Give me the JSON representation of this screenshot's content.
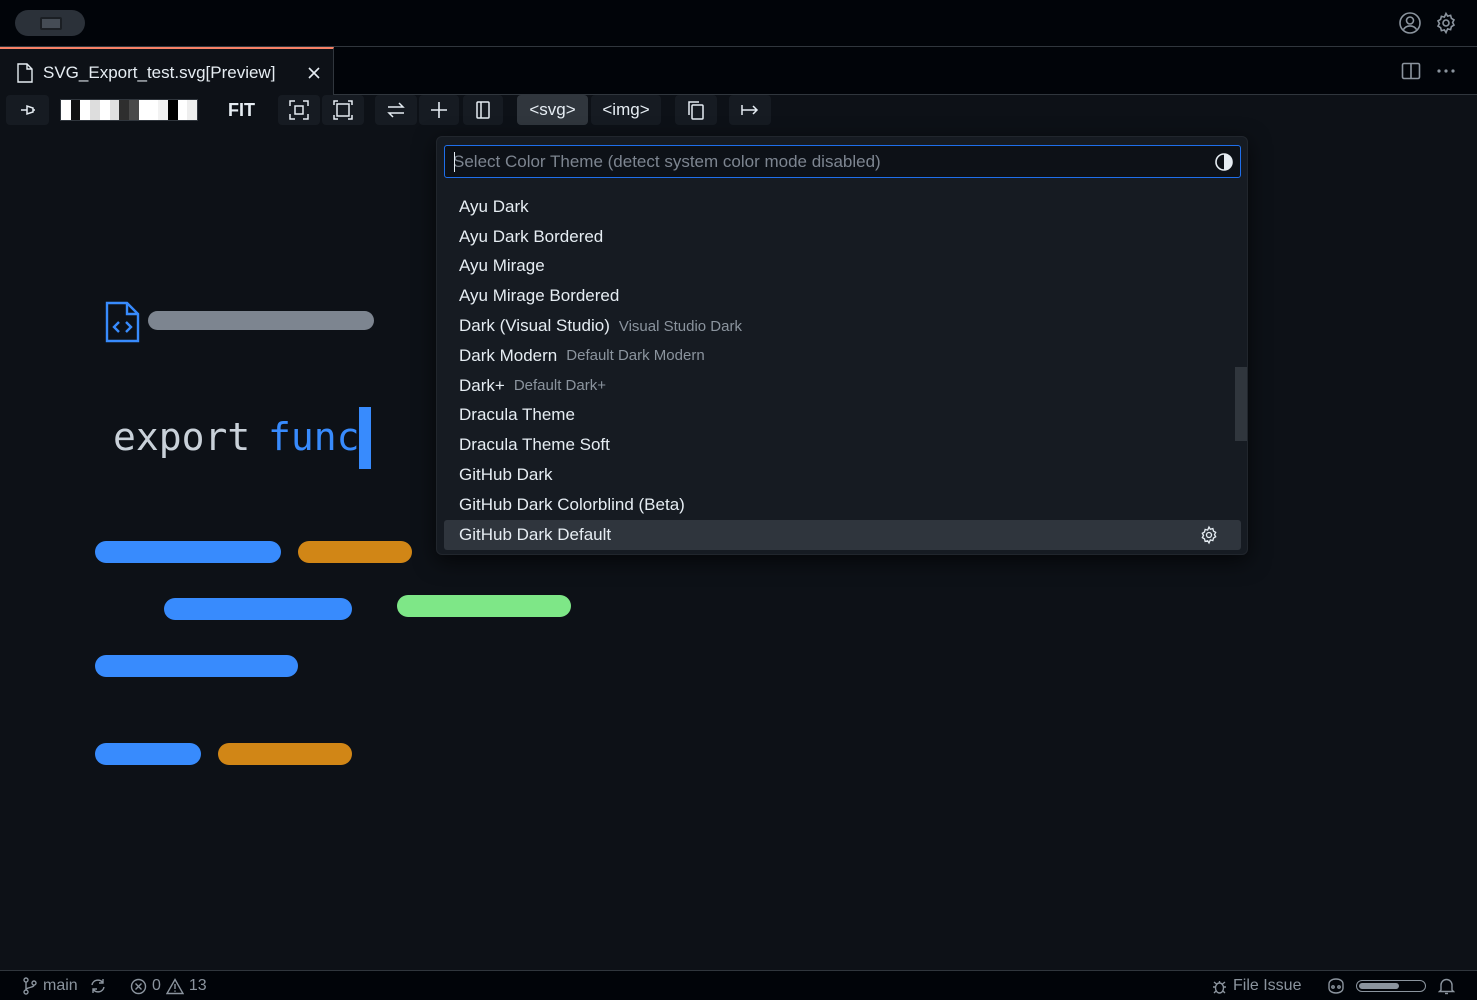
{
  "tab": {
    "title": "SVG_Export_test.svg[Preview]"
  },
  "toolbar": {
    "fit_label": "FIT",
    "svg_label": "<svg>",
    "img_label": "<img>",
    "background_swatches": [
      "#ffffff",
      "#111111",
      "#ffffff",
      "#dddddd",
      "#ffffff",
      "#e0e0e0",
      "#2e2e2e",
      "#4a4a4a",
      "#ffffff",
      "#ffffff",
      "#f2f2f2",
      "#000000",
      "#ffffff",
      "#eeeeee"
    ]
  },
  "preview": {
    "code_keyword": "export",
    "code_name": "func"
  },
  "quickpick": {
    "placeholder": "Select Color Theme (detect system color mode disabled)",
    "items": [
      {
        "label": "Ayu Dark",
        "description": ""
      },
      {
        "label": "Ayu Dark Bordered",
        "description": ""
      },
      {
        "label": "Ayu Mirage",
        "description": ""
      },
      {
        "label": "Ayu Mirage Bordered",
        "description": ""
      },
      {
        "label": "Dark (Visual Studio)",
        "description": "Visual Studio Dark"
      },
      {
        "label": "Dark Modern",
        "description": "Default Dark Modern"
      },
      {
        "label": "Dark+",
        "description": "Default Dark+"
      },
      {
        "label": "Dracula Theme",
        "description": ""
      },
      {
        "label": "Dracula Theme Soft",
        "description": ""
      },
      {
        "label": "GitHub Dark",
        "description": ""
      },
      {
        "label": "GitHub Dark Colorblind (Beta)",
        "description": ""
      },
      {
        "label": "GitHub Dark Default",
        "description": ""
      }
    ],
    "selected_index": 11
  },
  "statusbar": {
    "branch": "main",
    "errors": "0",
    "warnings": "13",
    "file_issue": "File Issue",
    "progress_fraction": 0.62
  },
  "colors": {
    "accent_blue": "#388bfd",
    "pill_orange": "#d18616",
    "pill_green": "#7ee787",
    "tab_accent": "#f78166"
  }
}
